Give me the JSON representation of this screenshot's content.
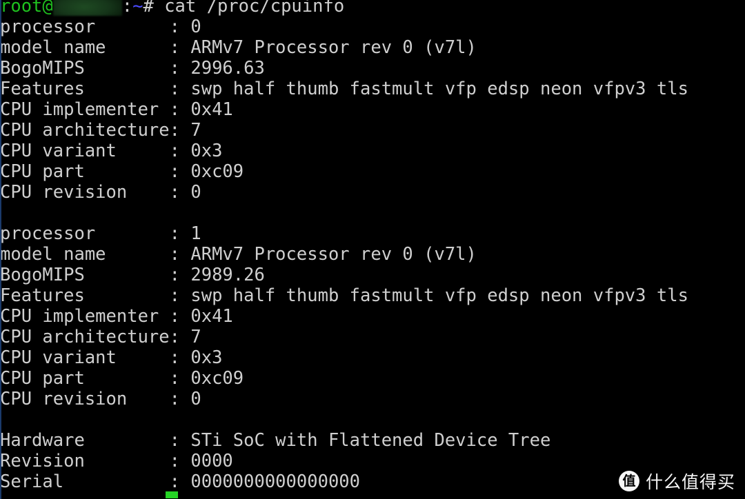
{
  "window": {
    "title": "root@ : ~ # cat /proc/cpuinfo",
    "background_color": "#000000",
    "foreground_color": "#cfcfcf",
    "left_border_color": "#1b3a6b"
  },
  "prompt": {
    "user": "root@",
    "user_color": "#1fc11f",
    "host_redacted": "",
    "colon": ":",
    "path": "~",
    "path_color": "#4a4aff",
    "sigil": "#",
    "command": " cat /proc/cpuinfo",
    "full_line": "root@          :~# cat /proc/cpuinfo"
  },
  "cursor": {
    "color": "#25d425",
    "visible": "true"
  },
  "cpuinfo": {
    "separator": ": ",
    "blocks": [
      {
        "fields": [
          {
            "key": "processor       ",
            "value": "0"
          },
          {
            "key": "model name      ",
            "value": "ARMv7 Processor rev 0 (v7l)"
          },
          {
            "key": "BogoMIPS        ",
            "value": "2996.63"
          },
          {
            "key": "Features        ",
            "value": "swp half thumb fastmult vfp edsp neon vfpv3 tls"
          },
          {
            "key": "CPU implementer ",
            "value": "0x41"
          },
          {
            "key": "CPU architecture",
            "value": "7",
            "tight": "true"
          },
          {
            "key": "CPU variant     ",
            "value": "0x3"
          },
          {
            "key": "CPU part        ",
            "value": "0xc09"
          },
          {
            "key": "CPU revision    ",
            "value": "0"
          }
        ]
      },
      {
        "fields": [
          {
            "key": "processor       ",
            "value": "1"
          },
          {
            "key": "model name      ",
            "value": "ARMv7 Processor rev 0 (v7l)"
          },
          {
            "key": "BogoMIPS        ",
            "value": "2989.26"
          },
          {
            "key": "Features        ",
            "value": "swp half thumb fastmult vfp edsp neon vfpv3 tls"
          },
          {
            "key": "CPU implementer ",
            "value": "0x41"
          },
          {
            "key": "CPU architecture",
            "value": "7",
            "tight": "true"
          },
          {
            "key": "CPU variant     ",
            "value": "0x3"
          },
          {
            "key": "CPU part        ",
            "value": "0xc09"
          },
          {
            "key": "CPU revision    ",
            "value": "0"
          }
        ]
      },
      {
        "fields": [
          {
            "key": "Hardware        ",
            "value": "STi SoC with Flattened Device Tree"
          },
          {
            "key": "Revision        ",
            "value": "0000"
          },
          {
            "key": "Serial          ",
            "value": "0000000000000000"
          }
        ]
      }
    ]
  },
  "lines": {
    "l01_key": "processor       ",
    "l01_val": "0",
    "l02_key": "model name      ",
    "l02_val": "ARMv7 Processor rev 0 (v7l)",
    "l03_key": "BogoMIPS        ",
    "l03_val": "2996.63",
    "l04_key": "Features        ",
    "l04_val": "swp half thumb fastmult vfp edsp neon vfpv3 tls",
    "l05_key": "CPU implementer ",
    "l05_val": "0x41",
    "l06_key": "CPU architecture",
    "l06_val": "7",
    "l07_key": "CPU variant     ",
    "l07_val": "0x3",
    "l08_key": "CPU part        ",
    "l08_val": "0xc09",
    "l09_key": "CPU revision    ",
    "l09_val": "0",
    "l11_key": "processor       ",
    "l11_val": "1",
    "l12_key": "model name      ",
    "l12_val": "ARMv7 Processor rev 0 (v7l)",
    "l13_key": "BogoMIPS        ",
    "l13_val": "2989.26",
    "l14_key": "Features        ",
    "l14_val": "swp half thumb fastmult vfp edsp neon vfpv3 tls",
    "l15_key": "CPU implementer ",
    "l15_val": "0x41",
    "l16_key": "CPU architecture",
    "l16_val": "7",
    "l17_key": "CPU variant     ",
    "l17_val": "0x3",
    "l18_key": "CPU part        ",
    "l18_val": "0xc09",
    "l19_key": "CPU revision    ",
    "l19_val": "0",
    "l21_key": "Hardware        ",
    "l21_val": "STi SoC with Flattened Device Tree",
    "l22_key": "Revision        ",
    "l22_val": "0000",
    "l23_key": "Serial          ",
    "l23_val": "0000000000000000",
    "sep": ": ",
    "sep_tight": ": "
  },
  "watermark": {
    "logo_char": "值",
    "text": "什么值得买"
  }
}
